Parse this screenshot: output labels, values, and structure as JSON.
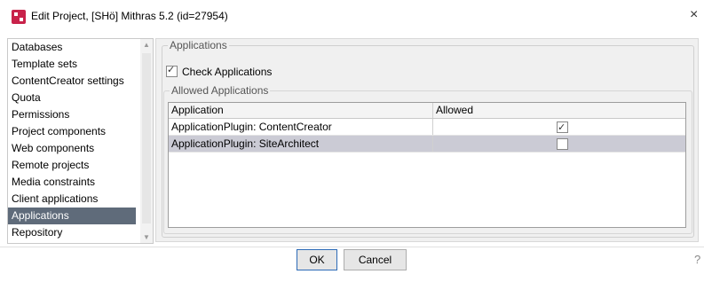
{
  "window": {
    "title": "Edit Project, [SHö] Mithras 5.2 (id=27954)",
    "close_glyph": "×",
    "app_icon": "firstspirit-app-icon"
  },
  "sidebar": {
    "items": [
      {
        "label": "Databases",
        "selected": false
      },
      {
        "label": "Template sets",
        "selected": false
      },
      {
        "label": "ContentCreator settings",
        "selected": false
      },
      {
        "label": "Quota",
        "selected": false
      },
      {
        "label": "Permissions",
        "selected": false
      },
      {
        "label": "Project components",
        "selected": false
      },
      {
        "label": "Web components",
        "selected": false
      },
      {
        "label": "Remote projects",
        "selected": false
      },
      {
        "label": "Media constraints",
        "selected": false
      },
      {
        "label": "Client applications",
        "selected": false
      },
      {
        "label": "Applications",
        "selected": true
      },
      {
        "label": "Repository",
        "selected": false
      }
    ]
  },
  "applications": {
    "group_title": "Applications",
    "check_label": "Check Applications",
    "check_checked": true,
    "allowed_group_title": "Allowed Applications",
    "columns": [
      "Application",
      "Allowed"
    ],
    "rows": [
      {
        "application": "ApplicationPlugin: ContentCreator",
        "allowed": true,
        "selected": false
      },
      {
        "application": "ApplicationPlugin: SiteArchitect",
        "allowed": false,
        "selected": true
      }
    ]
  },
  "footer": {
    "ok_label": "OK",
    "cancel_label": "Cancel",
    "help_glyph": "?"
  },
  "colors": {
    "selection_sidebar": "#5f6b7a",
    "selection_row": "#cbcbd5",
    "brand": "#c8224a"
  }
}
